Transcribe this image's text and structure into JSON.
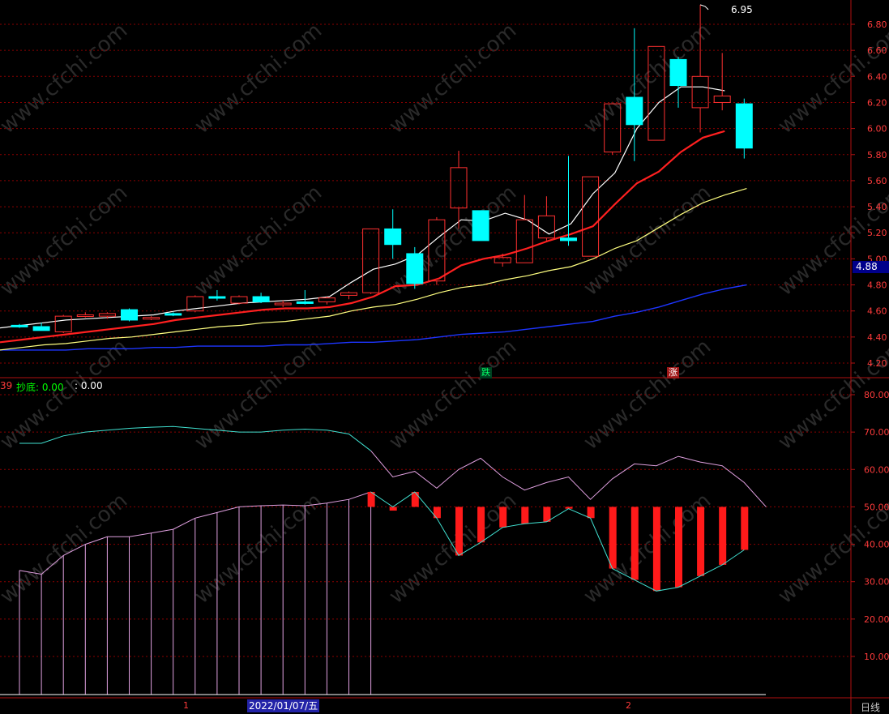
{
  "colors": {
    "background": "#000000",
    "up": "#ff3030",
    "down": "#00ffff",
    "grid": "#8b0000",
    "axis_text": "#ff3b3b",
    "ma5": "#ffffff",
    "ma10": "#ff2020",
    "ma20": "#ffff80",
    "ma60": "#1d35ff",
    "upper_line": "#40e0d0",
    "lower_line": "#e0a0e0"
  },
  "watermark": "www.cfchi.com",
  "price_tag": "4.88",
  "max_label": "6.95",
  "signal_down": "跌",
  "signal_up": "涨",
  "indicator_header": {
    "left_fragment": "39",
    "chaodi_label": "抄底: 0.00",
    "colon_label": ": 0.00"
  },
  "date_label": "2022/01/07/五",
  "period_label": "日线",
  "x_markers": [
    "1",
    "2"
  ],
  "chart_data": [
    {
      "type": "candlestick",
      "panel": "price",
      "yticks": [
        "6.80",
        "6.60",
        "6.40",
        "6.20",
        "6.00",
        "5.80",
        "5.60",
        "5.40",
        "5.20",
        "5.00",
        "4.80",
        "4.60",
        "4.40",
        "4.20"
      ],
      "ylim": [
        4.15,
        6.98
      ],
      "candles": [
        {
          "o": 4.49,
          "h": 4.5,
          "l": 4.47,
          "c": 4.48
        },
        {
          "o": 4.48,
          "h": 4.51,
          "l": 4.45,
          "c": 4.45
        },
        {
          "o": 4.44,
          "h": 4.57,
          "l": 4.43,
          "c": 4.56
        },
        {
          "o": 4.56,
          "h": 4.59,
          "l": 4.55,
          "c": 4.57
        },
        {
          "o": 4.56,
          "h": 4.59,
          "l": 4.54,
          "c": 4.58
        },
        {
          "o": 4.61,
          "h": 4.62,
          "l": 4.52,
          "c": 4.53
        },
        {
          "o": 4.54,
          "h": 4.56,
          "l": 4.53,
          "c": 4.55
        },
        {
          "o": 4.58,
          "h": 4.59,
          "l": 4.56,
          "c": 4.57
        },
        {
          "o": 4.6,
          "h": 4.72,
          "l": 4.59,
          "c": 4.71
        },
        {
          "o": 4.71,
          "h": 4.76,
          "l": 4.68,
          "c": 4.7
        },
        {
          "o": 4.66,
          "h": 4.72,
          "l": 4.65,
          "c": 4.71
        },
        {
          "o": 4.71,
          "h": 4.74,
          "l": 4.66,
          "c": 4.67
        },
        {
          "o": 4.65,
          "h": 4.68,
          "l": 4.63,
          "c": 4.66
        },
        {
          "o": 4.67,
          "h": 4.76,
          "l": 4.65,
          "c": 4.66
        },
        {
          "o": 4.67,
          "h": 4.71,
          "l": 4.65,
          "c": 4.7
        },
        {
          "o": 4.72,
          "h": 4.75,
          "l": 4.69,
          "c": 4.74
        },
        {
          "o": 4.74,
          "h": 5.23,
          "l": 4.73,
          "c": 5.23
        },
        {
          "o": 5.23,
          "h": 5.38,
          "l": 5.0,
          "c": 5.11
        },
        {
          "o": 5.04,
          "h": 5.09,
          "l": 4.77,
          "c": 4.81
        },
        {
          "o": 4.83,
          "h": 5.32,
          "l": 4.8,
          "c": 5.3
        },
        {
          "o": 5.39,
          "h": 5.83,
          "l": 5.23,
          "c": 5.7
        },
        {
          "o": 5.37,
          "h": 5.37,
          "l": 5.14,
          "c": 5.14
        },
        {
          "o": 4.97,
          "h": 5.04,
          "l": 4.94,
          "c": 5.01
        },
        {
          "o": 4.97,
          "h": 5.49,
          "l": 4.97,
          "c": 5.3
        },
        {
          "o": 5.16,
          "h": 5.48,
          "l": 5.14,
          "c": 5.33
        },
        {
          "o": 5.16,
          "h": 5.79,
          "l": 5.1,
          "c": 5.14
        },
        {
          "o": 5.02,
          "h": 5.63,
          "l": 5.02,
          "c": 5.63
        },
        {
          "o": 5.82,
          "h": 6.19,
          "l": 5.8,
          "c": 6.19
        },
        {
          "o": 6.24,
          "h": 6.77,
          "l": 5.75,
          "c": 6.03
        },
        {
          "o": 5.91,
          "h": 6.63,
          "l": 5.91,
          "c": 6.63
        },
        {
          "o": 6.53,
          "h": 6.55,
          "l": 6.16,
          "c": 6.33
        },
        {
          "o": 6.16,
          "h": 6.95,
          "l": 5.97,
          "c": 6.4
        },
        {
          "o": 6.2,
          "h": 6.58,
          "l": 6.14,
          "c": 6.25
        },
        {
          "o": 6.19,
          "h": 6.23,
          "l": 5.77,
          "c": 5.85
        }
      ],
      "ma5": [
        4.47,
        4.49,
        4.51,
        4.53,
        4.54,
        4.55,
        4.56,
        4.57,
        4.6,
        4.62,
        4.64,
        4.66,
        4.67,
        4.68,
        4.69,
        4.71,
        4.82,
        4.92,
        4.96,
        5.03,
        5.17,
        5.3,
        5.29,
        5.35,
        5.3,
        5.19,
        5.27,
        5.5,
        5.66,
        6.0,
        6.2,
        6.32,
        6.32,
        6.29
      ],
      "ma10": [
        4.36,
        4.38,
        4.4,
        4.42,
        4.44,
        4.46,
        4.48,
        4.5,
        4.53,
        4.55,
        4.57,
        4.59,
        4.61,
        4.62,
        4.62,
        4.63,
        4.66,
        4.71,
        4.79,
        4.8,
        4.85,
        4.95,
        5.0,
        5.03,
        5.08,
        5.14,
        5.19,
        5.25,
        5.42,
        5.58,
        5.67,
        5.82,
        5.93,
        5.98
      ],
      "ma20": [
        4.3,
        4.32,
        4.34,
        4.35,
        4.37,
        4.39,
        4.4,
        4.42,
        4.44,
        4.46,
        4.48,
        4.49,
        4.51,
        4.52,
        4.54,
        4.56,
        4.6,
        4.63,
        4.65,
        4.69,
        4.74,
        4.78,
        4.8,
        4.84,
        4.87,
        4.91,
        4.94,
        5.0,
        5.08,
        5.14,
        5.24,
        5.34,
        5.43,
        5.49,
        5.54
      ],
      "ma60": [
        4.3,
        4.3,
        4.3,
        4.3,
        4.31,
        4.31,
        4.31,
        4.32,
        4.32,
        4.33,
        4.33,
        4.33,
        4.33,
        4.34,
        4.34,
        4.35,
        4.36,
        4.36,
        4.37,
        4.38,
        4.4,
        4.42,
        4.43,
        4.44,
        4.46,
        4.48,
        4.5,
        4.52,
        4.56,
        4.59,
        4.63,
        4.68,
        4.73,
        4.77,
        4.8
      ]
    },
    {
      "type": "indicator",
      "panel": "lower",
      "yticks": [
        "80.00",
        "70.00",
        "60.00",
        "50.00",
        "40.00",
        "30.00",
        "20.00",
        "10.00"
      ],
      "ylim": [
        0,
        85
      ],
      "baseline": 50,
      "upper_line": [
        67,
        67,
        69,
        70,
        70.5,
        71,
        71.3,
        71.5,
        71,
        70.5,
        70,
        70,
        70.5,
        70.8,
        70.5,
        69.5,
        65,
        58,
        59.5,
        55,
        60,
        63,
        58,
        54.5,
        56.5,
        58,
        52,
        57.5,
        61.5,
        61,
        63.5,
        62,
        61,
        56.5,
        50
      ],
      "lower_line": [
        33,
        32,
        37,
        40,
        42,
        42,
        43,
        44,
        47,
        48.5,
        50,
        50.3,
        50.5,
        50.3,
        51,
        52,
        54
      ],
      "bars": [
        {
          "i": 16,
          "v": 54
        },
        {
          "i": 17,
          "v": 49
        },
        {
          "i": 18,
          "v": 54
        },
        {
          "i": 19,
          "v": 47
        },
        {
          "i": 20,
          "v": 37
        },
        {
          "i": 21,
          "v": 40.5
        },
        {
          "i": 22,
          "v": 44.5
        },
        {
          "i": 23,
          "v": 45.5
        },
        {
          "i": 24,
          "v": 46
        },
        {
          "i": 25,
          "v": 49.5
        },
        {
          "i": 26,
          "v": 47
        },
        {
          "i": 27,
          "v": 33.5
        },
        {
          "i": 28,
          "v": 30.5
        },
        {
          "i": 29,
          "v": 27.5
        },
        {
          "i": 30,
          "v": 28.5
        },
        {
          "i": 31,
          "v": 31.5
        },
        {
          "i": 32,
          "v": 34.5
        },
        {
          "i": 33,
          "v": 38.5
        }
      ],
      "trough_line_start": 16,
      "trough_line": [
        54,
        50,
        54,
        47,
        37,
        40.5,
        44.5,
        45.5,
        46,
        49.5,
        47,
        33.5,
        30.5,
        27.5,
        28.5,
        31.5,
        34.5,
        38.5
      ]
    }
  ]
}
